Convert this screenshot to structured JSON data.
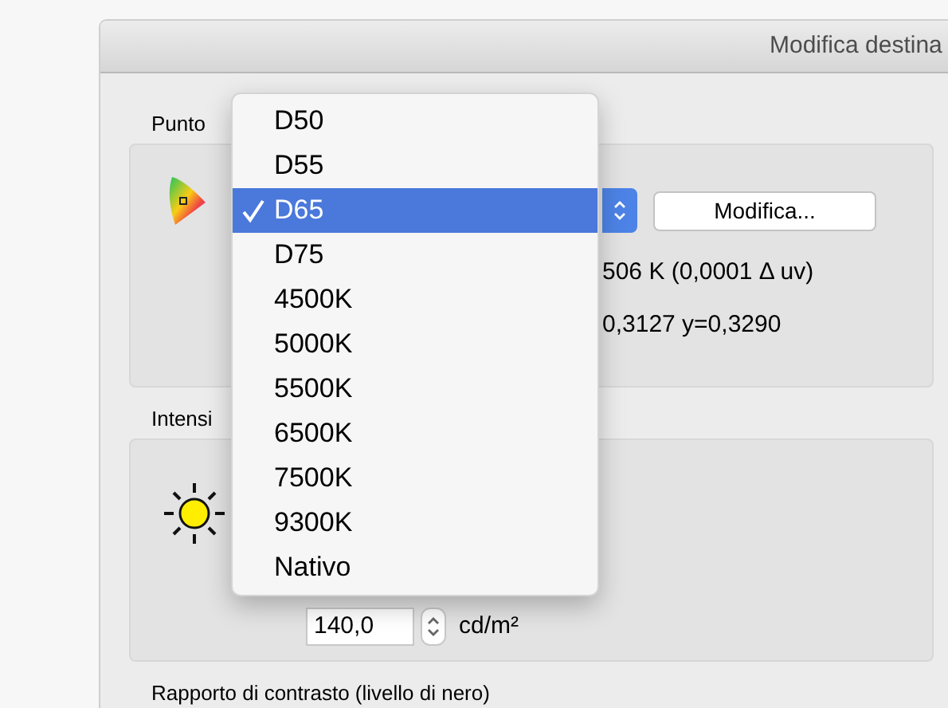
{
  "window": {
    "title": "Modifica destina"
  },
  "white_point": {
    "label": "Punto",
    "button": "Modifica...",
    "temperature": "506 K (0,0001 Δ uv)",
    "cie": "0,3127 y=0,3290"
  },
  "menu": {
    "items": [
      {
        "label": "D50",
        "selected": false
      },
      {
        "label": "D55",
        "selected": false
      },
      {
        "label": "D65",
        "selected": true
      },
      {
        "label": "D75",
        "selected": false
      },
      {
        "label": "4500K",
        "selected": false
      },
      {
        "label": "5000K",
        "selected": false
      },
      {
        "label": "5500K",
        "selected": false
      },
      {
        "label": "6500K",
        "selected": false
      },
      {
        "label": "7500K",
        "selected": false
      },
      {
        "label": "9300K",
        "selected": false
      },
      {
        "label": "Nativo",
        "selected": false
      }
    ]
  },
  "intensity": {
    "label": "Intensi",
    "value": "140,0",
    "unit": "cd/m²"
  },
  "contrast": {
    "label": "Rapporto di contrasto (livello di nero)"
  }
}
